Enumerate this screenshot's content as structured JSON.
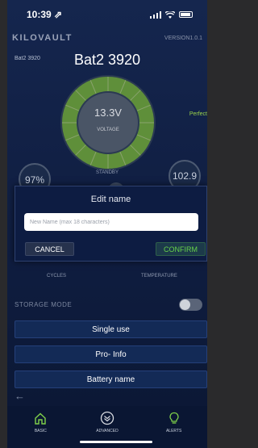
{
  "status_bar": {
    "time": "10:39 ⇗"
  },
  "header": {
    "brand": "KILOVAULT",
    "version": "VERSION1.0.1"
  },
  "battery": {
    "small_label": "Bat2 3920",
    "title": "Bat2 3920",
    "voltage": "13.3V",
    "voltage_label": "VOLTAGE",
    "health": "Perfect",
    "state": "STANDBY",
    "soc": "97%",
    "temp": "102.9"
  },
  "labels": {
    "cycles": "CYCLES",
    "temperature": "TEMPERATURE"
  },
  "dialog": {
    "title": "Edit name",
    "placeholder": "New Name (max 18 characters)",
    "cancel": "CANCEL",
    "confirm": "CONFIRM"
  },
  "storage": {
    "label": "STORAGE MODE",
    "on": false
  },
  "menu": {
    "single_use": "Single use",
    "pro_info": "Pro- Info",
    "battery_name": "Battery name"
  },
  "nav": {
    "basic": "BASIC",
    "advanced": "ADVANCED",
    "alerts": "ALERTS"
  },
  "colors": {
    "accent_green": "#67d24a",
    "gauge_green": "#5f8f3a",
    "background": "#0e1a3a"
  }
}
